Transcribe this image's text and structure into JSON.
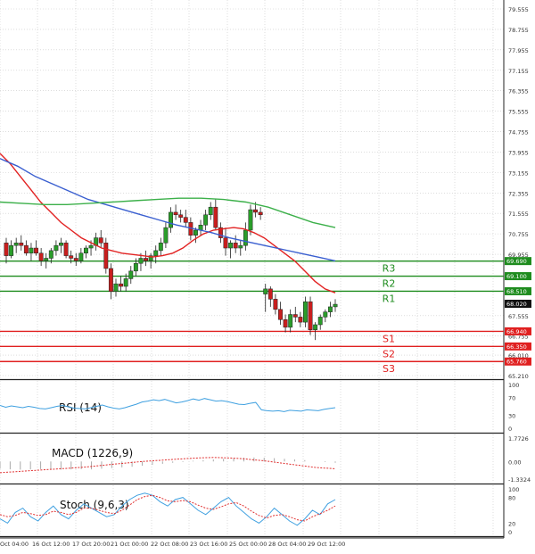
{
  "chart_data": {
    "type": "candlestick",
    "instrument_panel": {
      "price_axis_ticks": [
        "79.555",
        "78.755",
        "77.955",
        "77.155",
        "76.355",
        "75.555",
        "74.755",
        "73.955",
        "73.155",
        "72.355",
        "71.555",
        "70.755",
        "69.955",
        "67.555",
        "66.755",
        "66.010",
        "65.210"
      ],
      "levels": [
        {
          "label": "R3",
          "value": 69.69,
          "value_text": "69.690",
          "color": "#1e8c1e"
        },
        {
          "label": "R2",
          "value": 69.1,
          "value_text": "69.100",
          "color": "#1e8c1e"
        },
        {
          "label": "R1",
          "value": 68.51,
          "value_text": "68.510",
          "color": "#1e8c1e"
        },
        {
          "label": "S1",
          "value": 66.94,
          "value_text": "66.940",
          "color": "#e02020"
        },
        {
          "label": "S2",
          "value": 66.35,
          "value_text": "66.350",
          "color": "#e02020"
        },
        {
          "label": "S3",
          "value": 65.76,
          "value_text": "65.760",
          "color": "#e02020"
        }
      ],
      "current_price": {
        "value": 68.02,
        "text": "68.020"
      },
      "candles": [
        [
          70.4,
          70.6,
          69.6,
          69.9
        ],
        [
          69.9,
          70.5,
          69.8,
          70.3
        ],
        [
          70.3,
          70.6,
          70.0,
          70.4
        ],
        [
          70.4,
          70.7,
          70.1,
          70.3
        ],
        [
          70.3,
          70.5,
          69.9,
          70.0
        ],
        [
          70.0,
          70.4,
          69.7,
          70.2
        ],
        [
          70.2,
          70.5,
          69.9,
          70.0
        ],
        [
          70.0,
          70.2,
          69.5,
          69.7
        ],
        [
          69.7,
          70.0,
          69.4,
          69.8
        ],
        [
          69.8,
          70.2,
          69.6,
          70.1
        ],
        [
          70.1,
          70.5,
          69.9,
          70.3
        ],
        [
          70.3,
          70.6,
          70.0,
          70.4
        ],
        [
          70.4,
          70.5,
          69.8,
          69.9
        ],
        [
          69.9,
          70.1,
          69.6,
          69.8
        ],
        [
          69.8,
          70.0,
          69.5,
          69.7
        ],
        [
          69.7,
          70.2,
          69.6,
          70.0
        ],
        [
          70.0,
          70.3,
          69.8,
          70.2
        ],
        [
          70.2,
          70.5,
          69.9,
          70.3
        ],
        [
          70.3,
          70.8,
          70.1,
          70.6
        ],
        [
          70.6,
          70.9,
          70.2,
          70.4
        ],
        [
          70.4,
          70.6,
          69.2,
          69.4
        ],
        [
          69.4,
          69.6,
          68.2,
          68.5
        ],
        [
          68.5,
          69.0,
          68.3,
          68.8
        ],
        [
          68.8,
          69.1,
          68.5,
          68.7
        ],
        [
          68.7,
          69.2,
          68.5,
          69.0
        ],
        [
          69.0,
          69.5,
          68.8,
          69.3
        ],
        [
          69.3,
          69.8,
          69.1,
          69.6
        ],
        [
          69.6,
          70.0,
          69.3,
          69.8
        ],
        [
          69.8,
          70.1,
          69.5,
          69.7
        ],
        [
          69.7,
          70.0,
          69.4,
          69.9
        ],
        [
          69.9,
          70.3,
          69.6,
          70.1
        ],
        [
          70.1,
          70.6,
          69.9,
          70.4
        ],
        [
          70.4,
          71.2,
          70.2,
          71.0
        ],
        [
          71.0,
          71.8,
          70.8,
          71.6
        ],
        [
          71.6,
          71.9,
          71.3,
          71.5
        ],
        [
          71.5,
          71.7,
          71.2,
          71.4
        ],
        [
          71.4,
          71.7,
          71.0,
          71.2
        ],
        [
          71.2,
          71.4,
          70.5,
          70.7
        ],
        [
          70.7,
          71.0,
          70.4,
          70.9
        ],
        [
          70.9,
          71.3,
          70.7,
          71.1
        ],
        [
          71.1,
          71.7,
          70.9,
          71.5
        ],
        [
          71.5,
          72.0,
          71.3,
          71.8
        ],
        [
          71.8,
          72.1,
          70.9,
          71.0
        ],
        [
          71.0,
          71.2,
          70.4,
          70.6
        ],
        [
          70.6,
          71.0,
          69.9,
          70.2
        ],
        [
          70.2,
          70.5,
          69.8,
          70.4
        ],
        [
          70.4,
          70.7,
          70.0,
          70.2
        ],
        [
          70.2,
          70.5,
          69.9,
          70.3
        ],
        [
          70.3,
          71.2,
          70.1,
          70.9
        ],
        [
          70.9,
          71.9,
          70.7,
          71.7
        ],
        [
          71.7,
          72.0,
          71.4,
          71.6
        ],
        [
          71.6,
          71.8,
          71.3,
          71.5
        ],
        [
          68.4,
          68.8,
          67.7,
          68.6
        ],
        [
          68.6,
          68.7,
          67.9,
          68.2
        ],
        [
          68.2,
          68.4,
          67.6,
          67.8
        ],
        [
          67.8,
          68.1,
          67.2,
          67.4
        ],
        [
          67.4,
          67.6,
          66.9,
          67.1
        ],
        [
          67.1,
          67.8,
          66.9,
          67.6
        ],
        [
          67.6,
          67.9,
          67.3,
          67.5
        ],
        [
          67.5,
          67.7,
          67.1,
          67.3
        ],
        [
          67.3,
          68.3,
          67.1,
          68.1
        ],
        [
          68.1,
          68.3,
          66.8,
          67.0
        ],
        [
          67.0,
          67.3,
          66.6,
          67.2
        ],
        [
          67.2,
          67.6,
          67.0,
          67.5
        ],
        [
          67.5,
          67.8,
          67.3,
          67.7
        ],
        [
          67.7,
          68.1,
          67.5,
          67.9
        ],
        [
          67.9,
          68.2,
          67.7,
          68.0
        ]
      ],
      "ma_fast": [
        73.9,
        73.5,
        73.0,
        72.5,
        72.0,
        71.6,
        71.2,
        70.9,
        70.6,
        70.4,
        70.2,
        70.1,
        70.0,
        69.95,
        69.9,
        69.85,
        69.9,
        70.0,
        70.2,
        70.5,
        70.75,
        70.9,
        70.95,
        71.0,
        70.95,
        70.8,
        70.6,
        70.3,
        70.0,
        69.7,
        69.3,
        68.9,
        68.6,
        68.45
      ],
      "ma_mid": [
        73.7,
        73.4,
        73.0,
        72.7,
        72.4,
        72.1,
        71.9,
        71.7,
        71.5,
        71.3,
        71.1,
        70.95,
        70.8,
        70.6,
        70.45,
        70.3,
        70.15,
        70.0,
        69.85,
        69.7
      ],
      "ma_slow": [
        72.0,
        71.95,
        71.9,
        71.9,
        71.95,
        72.0,
        72.05,
        72.1,
        72.15,
        72.15,
        72.1,
        72.0,
        71.8,
        71.5,
        71.2,
        71.0
      ]
    },
    "rsi": {
      "title": "RSI (14)",
      "ticks": [
        "100",
        "70",
        "30",
        "0"
      ],
      "values": [
        52,
        48,
        51,
        49,
        47,
        50,
        48,
        45,
        44,
        47,
        50,
        52,
        49,
        46,
        45,
        44,
        47,
        50,
        53,
        49,
        46,
        44,
        47,
        51,
        55,
        60,
        62,
        65,
        63,
        66,
        62,
        58,
        60,
        63,
        67,
        64,
        68,
        65,
        62,
        63,
        61,
        58,
        55,
        54,
        57,
        59,
        42,
        40,
        39,
        40,
        38,
        41,
        40,
        39,
        42,
        41,
        40,
        43,
        45,
        47
      ]
    },
    "macd": {
      "title": "MACD (1226,9)",
      "ticks": [
        "1.7726",
        "0.00",
        "-1.3324"
      ],
      "histogram": [
        -0.55,
        -0.6,
        -0.62,
        -0.6,
        -0.58,
        -0.6,
        -0.62,
        -0.6,
        -0.58,
        -0.6,
        -0.55,
        -0.5,
        -0.45,
        -0.4,
        -0.32,
        -0.25,
        -0.18,
        -0.1,
        -0.05,
        0.05,
        0.1,
        0.15,
        0.2,
        0.25,
        0.28,
        0.3,
        0.28,
        0.25,
        0.2,
        0.15,
        0.1,
        0.0,
        -0.05,
        -0.1
      ],
      "signal": [
        -0.85,
        -0.8,
        -0.75,
        -0.7,
        -0.65,
        -0.6,
        -0.55,
        -0.5,
        -0.45,
        -0.38,
        -0.3,
        -0.22,
        -0.15,
        -0.08,
        0.0,
        0.05,
        0.1,
        0.15,
        0.2,
        0.25,
        0.28,
        0.3,
        0.28,
        0.25,
        0.2,
        0.12,
        0.05,
        -0.05,
        -0.15,
        -0.25,
        -0.35,
        -0.45,
        -0.5,
        -0.55
      ]
    },
    "stoch": {
      "title": "Stoch (9,6,3)",
      "ticks": [
        "100",
        "80",
        "20",
        "0"
      ],
      "k": [
        30,
        20,
        45,
        55,
        35,
        25,
        45,
        60,
        40,
        30,
        50,
        65,
        55,
        45,
        35,
        40,
        60,
        75,
        85,
        90,
        85,
        70,
        60,
        75,
        80,
        65,
        50,
        40,
        55,
        70,
        80,
        60,
        45,
        30,
        20,
        35,
        55,
        40,
        25,
        15,
        30,
        50,
        40,
        65,
        75
      ],
      "d": [
        40,
        35,
        38,
        45,
        42,
        38,
        40,
        48,
        45,
        40,
        45,
        55,
        55,
        50,
        45,
        42,
        50,
        62,
        75,
        82,
        85,
        80,
        72,
        70,
        73,
        70,
        62,
        55,
        52,
        58,
        65,
        68,
        60,
        48,
        38,
        32,
        38,
        40,
        35,
        28,
        25,
        35,
        42,
        50,
        60
      ]
    },
    "x_ticks": [
      "Oct 04:00",
      "16 Oct 12:00",
      "17 Oct 20:00",
      "21 Oct 00:00",
      "22 Oct 08:00",
      "23 Oct 16:00",
      "25 Oct 00:00",
      "28 Oct 04:00",
      "29 Oct 12:00"
    ]
  }
}
